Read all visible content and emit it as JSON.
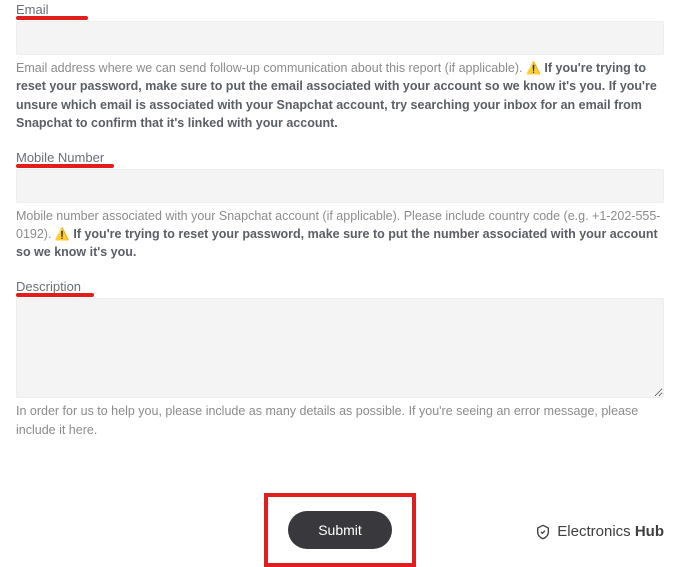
{
  "email": {
    "label": "Email",
    "help_plain": "Email address where we can send follow-up communication about this report (if applicable). ",
    "help_bold": "If you're trying to reset your password, make sure to put the email associated with your account so we know it's you. If you're unsure which email is associated with your Snapchat account, try searching your inbox for an email from Snapchat to confirm that it's linked with your account."
  },
  "mobile": {
    "label": "Mobile Number",
    "help_plain": "Mobile number associated with your Snapchat account (if applicable). Please include country code (e.g. +1-202-555-0192). ",
    "help_bold": "If you're trying to reset your password, make sure to put the number associated with your account so we know it's you."
  },
  "description": {
    "label": "Description",
    "help_plain": "In order for us to help you, please include as many details as possible. If you're seeing an error message, please include it here."
  },
  "submit_label": "Submit",
  "warn_icon": "⚠️",
  "brand": {
    "ele": "Electronics ",
    "hub": "Hub"
  }
}
